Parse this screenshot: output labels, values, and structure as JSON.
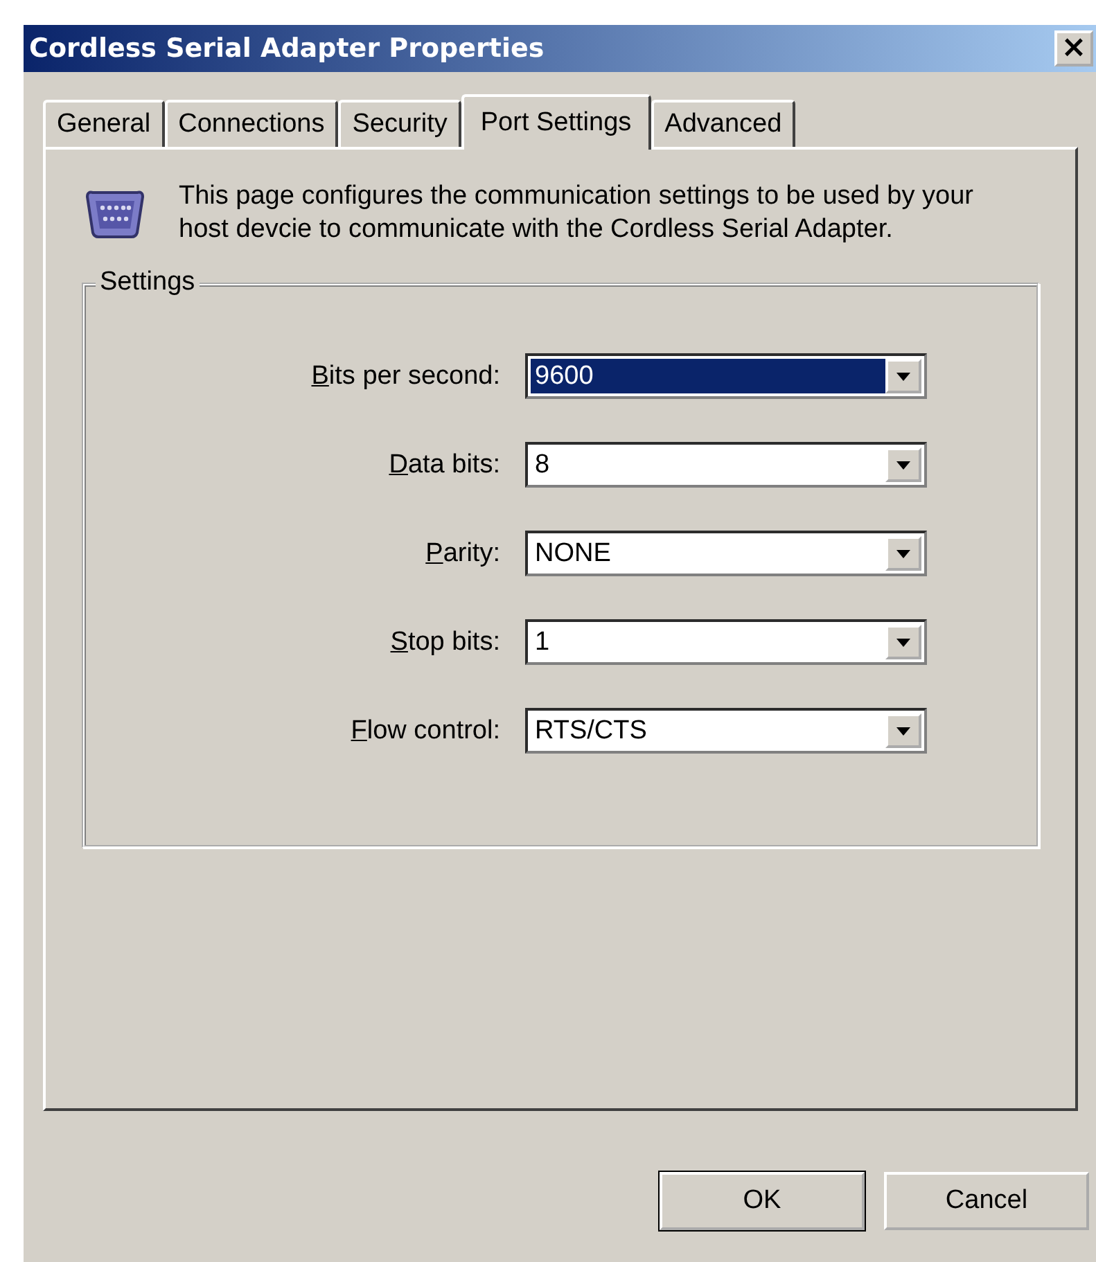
{
  "window": {
    "title": "Cordless Serial Adapter Properties",
    "close": "×"
  },
  "tabs": [
    {
      "label": "General",
      "selected": false
    },
    {
      "label": "Connections",
      "selected": false
    },
    {
      "label": "Security",
      "selected": false
    },
    {
      "label": "Port Settings",
      "selected": true
    },
    {
      "label": "Advanced",
      "selected": false
    }
  ],
  "description": "This page configures the communication settings to be used by your host devcie to communicate with the Cordless Serial Adapter.",
  "group": {
    "title": "Settings",
    "fields": [
      {
        "label": "Bits per second:",
        "first_letter_underlined": true,
        "value": "9600",
        "focused": true
      },
      {
        "label": "Data bits:",
        "first_letter_underlined": true,
        "value": "8",
        "focused": false
      },
      {
        "label": "Parity:",
        "first_letter_underlined": true,
        "value": "NONE",
        "focused": false
      },
      {
        "label": "Stop bits:",
        "first_letter_underlined": true,
        "value": "1",
        "focused": false
      },
      {
        "label": "Flow control:",
        "first_letter_underlined": true,
        "value": "RTS/CTS",
        "focused": false
      }
    ]
  },
  "buttons": [
    {
      "label": "OK",
      "default": true
    },
    {
      "label": "Cancel",
      "default": false
    }
  ]
}
